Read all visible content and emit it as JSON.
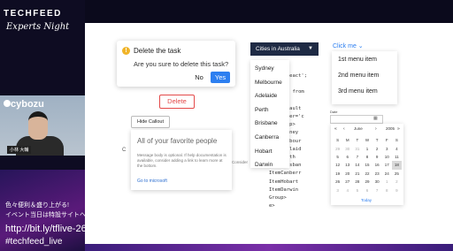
{
  "overlay": {
    "brand": "TECHFEED",
    "brand_sub": "Experts Night",
    "company": "cybozu",
    "speaker_name": "小林 大輔",
    "promo_line1": "色々便利＆盛り上がる!",
    "promo_line2": "イベント当日は特設サイトへ",
    "promo_url": "http://bit.ly/tflive-26",
    "hashtag": "#techfeed_live"
  },
  "dialog": {
    "title": "Delete the task",
    "message": "Are you sure to delete this task?",
    "no_label": "No",
    "yes_label": "Yes"
  },
  "delete_button": "Delete",
  "callout": {
    "toggle_label": "Hide Callout",
    "title": "All of your favorite people",
    "body": "Message body is optional. If help documentation is available, consider adding a link to learn more at the bottom.",
    "link": "Go to microsoft",
    "glyph": "C",
    "after_text": "Consider"
  },
  "dropdown": {
    "label": "Cities in Australia",
    "options": [
      "Sydney",
      "Melbourne",
      "Adelaide",
      "Perth",
      "Brisbane",
      "Canberra",
      "Hobart",
      "Darwin"
    ]
  },
  "menu": {
    "trigger": "Click me",
    "items": [
      "1st menu item",
      "2nd menu item",
      "3rd menu item"
    ]
  },
  "code_lines": [
    "from 'react';",
    "",
    "Menu, } from",
    "",
    "MenuDefault",
    "u trigger='c",
    "ontGroup>",
    "ItemSydney",
    "ItemMelbour",
    "ItemAdelaid",
    "ItemPerth",
    "ItemBrisban",
    "ItemCanberr",
    "ItemHobart",
    "ItemDarwin",
    "Group>",
    "e>"
  ],
  "calendar": {
    "field_label": "Date",
    "month": "June",
    "year": "2005",
    "weekdays": [
      "S",
      "M",
      "T",
      "W",
      "T",
      "F",
      "S"
    ],
    "weeks": [
      [
        "29",
        "30",
        "31",
        "1",
        "2",
        "3",
        "4"
      ],
      [
        "5",
        "6",
        "7",
        "8",
        "9",
        "10",
        "11"
      ],
      [
        "12",
        "13",
        "14",
        "15",
        "16",
        "17",
        "18"
      ],
      [
        "19",
        "20",
        "21",
        "22",
        "23",
        "24",
        "25"
      ],
      [
        "26",
        "27",
        "28",
        "29",
        "30",
        "1",
        "2"
      ],
      [
        "3",
        "4",
        "5",
        "6",
        "7",
        "8",
        "9"
      ]
    ],
    "selected": "18",
    "today_label": "Today"
  }
}
